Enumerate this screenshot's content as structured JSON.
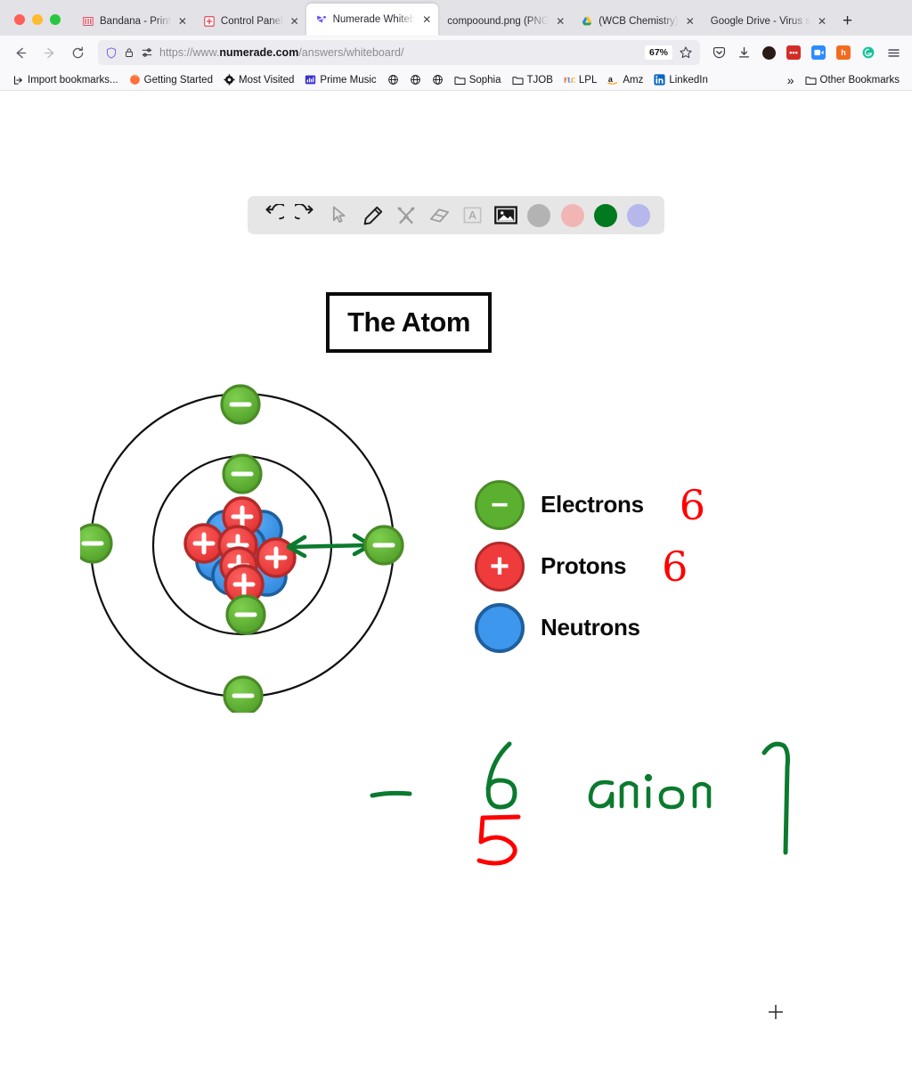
{
  "browser": {
    "window_controls": [
      "close",
      "minimize",
      "maximize"
    ],
    "tabs": [
      {
        "label": "Bandana - Print",
        "favicon": "bandana-icon",
        "close": "✕",
        "active": false
      },
      {
        "label": "Control Panel",
        "favicon": "control-panel-icon",
        "close": "✕",
        "active": false
      },
      {
        "label": "Numerade Whiteb",
        "favicon": "numerade-icon",
        "close": "✕",
        "active": true
      },
      {
        "label": "compoound.png (PNG",
        "favicon": "none",
        "close": "✕",
        "active": false
      },
      {
        "label": "(WCB Chemistry)",
        "favicon": "google-drive-icon",
        "close": "✕",
        "active": false
      },
      {
        "label": "Google Drive - Virus s",
        "favicon": "none",
        "close": "✕",
        "active": false
      }
    ],
    "new_tab_label": "+",
    "nav": {
      "back": "←",
      "forward": "→",
      "reload": "↻"
    },
    "url": {
      "prefix": "https://www.",
      "domain": "numerade.com",
      "path": "/answers/whiteboard/",
      "zoom": "67%",
      "shield_icon": "shield-icon",
      "lock_icon": "lock-icon",
      "permissions_icon": "permissions-icon",
      "bookmark_star_icon": "star-icon"
    },
    "extensions": [
      {
        "name": "pocket-icon",
        "color": "#3a3a44"
      },
      {
        "name": "downloads-icon",
        "color": "#3a3a44"
      },
      {
        "name": "account-avatar",
        "color": "#2b1b16"
      },
      {
        "name": "lastpass-icon",
        "color": "#d32d27"
      },
      {
        "name": "zoom-icon",
        "color": "#2d8cff"
      },
      {
        "name": "honey-icon",
        "color": "#f26b21"
      },
      {
        "name": "grammarly-icon",
        "color": "#15c39a"
      },
      {
        "name": "app-menu-icon",
        "color": "#3a3a44"
      }
    ],
    "bookmarks": [
      {
        "label": "Import bookmarks...",
        "icon": "import-icon"
      },
      {
        "label": "Getting Started",
        "icon": "firefox-icon"
      },
      {
        "label": "Most Visited",
        "icon": "gear-icon"
      },
      {
        "label": "Prime Music",
        "icon": "prime-music-icon"
      },
      {
        "label": "",
        "icon": "globe-icon"
      },
      {
        "label": "",
        "icon": "globe-icon"
      },
      {
        "label": "",
        "icon": "globe-icon"
      },
      {
        "label": "Sophia",
        "icon": "folder-icon"
      },
      {
        "label": "TJOB",
        "icon": "folder-icon"
      },
      {
        "label": "LPL",
        "icon": "flc-icon"
      },
      {
        "label": "Amz",
        "icon": "amazon-icon"
      },
      {
        "label": "LinkedIn",
        "icon": "linkedin-icon"
      }
    ],
    "bookmarks_overflow": "»",
    "other_bookmarks": {
      "label": "Other Bookmarks",
      "icon": "folder-icon"
    }
  },
  "whiteboard": {
    "toolbar": {
      "tools": [
        {
          "name": "undo-icon",
          "active": false
        },
        {
          "name": "redo-icon",
          "active": false
        },
        {
          "name": "select-cursor-icon",
          "active": false
        },
        {
          "name": "pencil-icon",
          "active": true
        },
        {
          "name": "shapes-tools-icon",
          "active": false
        },
        {
          "name": "eraser-icon",
          "active": false
        },
        {
          "name": "text-icon",
          "active": false
        },
        {
          "name": "image-icon",
          "active": true
        }
      ],
      "colors": [
        {
          "name": "color-gray",
          "hex": "#b3b3b3",
          "selected": false
        },
        {
          "name": "color-pink",
          "hex": "#f2b5b5",
          "selected": false
        },
        {
          "name": "color-green",
          "hex": "#00791f",
          "selected": true
        },
        {
          "name": "color-purple",
          "hex": "#b7b7ec",
          "selected": false
        }
      ]
    },
    "title_box": {
      "text": "The Atom"
    },
    "atom_diagram": {
      "name": "bohr-model-atom",
      "outer_shell_electrons": 4,
      "inner_shell_electrons": 2,
      "nucleus_protons": 5,
      "nucleus_neutrons": 7,
      "annotation_arrow": "double-headed-green-arrow",
      "electron_sign": "−",
      "proton_sign": "+",
      "colors": {
        "electron": "#5cb030",
        "electron_border": "#4a8c27",
        "proton": "#ef3b3b",
        "proton_border": "#b32a2a",
        "neutron": "#3d97ec",
        "neutron_border": "#1e5f9e",
        "shell": "#0a0a0a",
        "arrow": "#0b7a2e"
      }
    },
    "legend": [
      {
        "label": "Electrons",
        "type": "electron",
        "sign": "−",
        "count": "6"
      },
      {
        "label": "Protons",
        "type": "proton",
        "sign": "+",
        "count": "6"
      },
      {
        "label": "Neutrons",
        "type": "neutron",
        "sign": "",
        "count": ""
      }
    ],
    "annotations": [
      {
        "name": "ink-dash",
        "text": "—",
        "color": "#0b7a2e"
      },
      {
        "name": "ink-six",
        "text": "6",
        "color": "#0b7a2e"
      },
      {
        "name": "ink-five",
        "text": "5",
        "color": "#ff0000"
      },
      {
        "name": "ink-anion",
        "text": "anion",
        "color": "#0b7a2e"
      },
      {
        "name": "ink-q",
        "text": "q",
        "color": "#0b7a2e"
      }
    ],
    "cursor": {
      "name": "crosshair-cursor",
      "glyph": "+"
    }
  }
}
